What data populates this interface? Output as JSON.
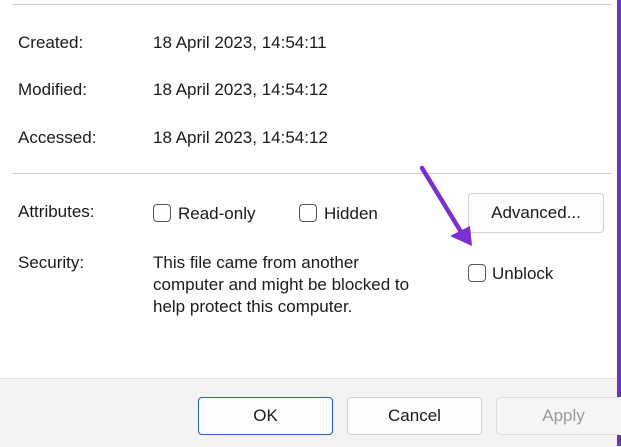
{
  "timestamps": {
    "created_label": "Created:",
    "created_value": "18 April 2023, 14:54:11",
    "modified_label": "Modified:",
    "modified_value": "18 April 2023, 14:54:12",
    "accessed_label": "Accessed:",
    "accessed_value": "18 April 2023, 14:54:12"
  },
  "attributes": {
    "label": "Attributes:",
    "readonly_label": "Read-only",
    "readonly_checked": false,
    "hidden_label": "Hidden",
    "hidden_checked": false,
    "advanced_button": "Advanced..."
  },
  "security": {
    "label": "Security:",
    "message_lines": [
      "This file came from another",
      "computer and might be blocked to",
      "help protect this computer."
    ],
    "unblock_label": "Unblock",
    "unblock_checked": false
  },
  "buttons": {
    "ok": "OK",
    "cancel": "Cancel",
    "apply": "Apply",
    "apply_enabled": false
  },
  "colors": {
    "annotation_arrow": "#7b2fd0",
    "window_border": "#6a35b6",
    "ok_border": "#1f5fbf"
  }
}
